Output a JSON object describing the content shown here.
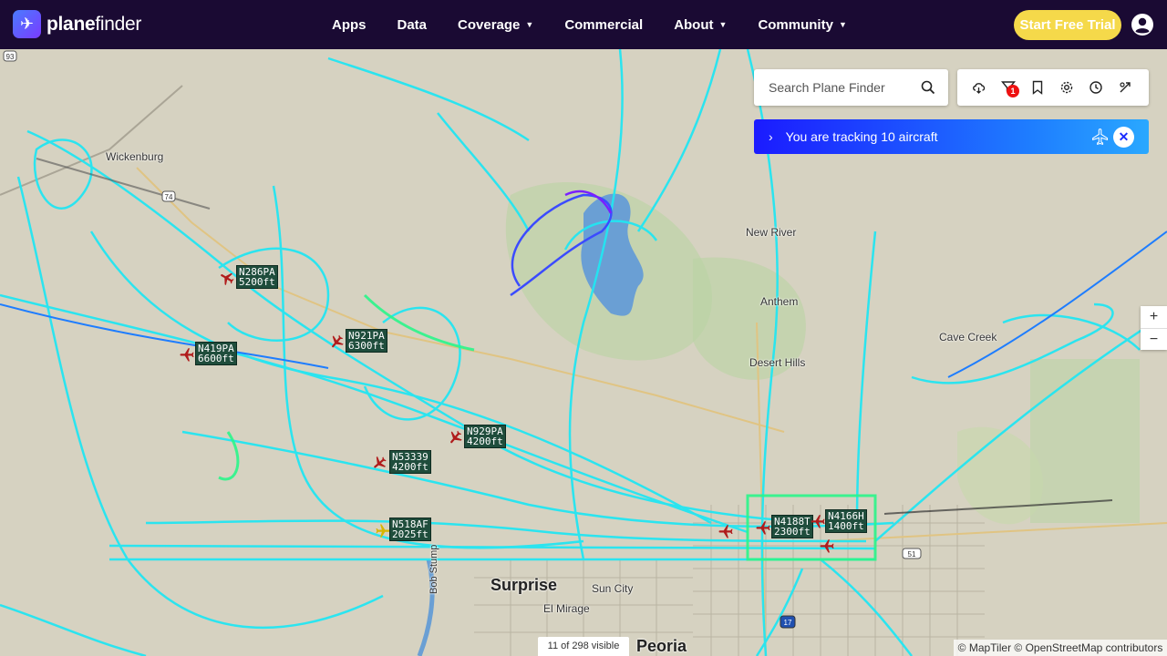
{
  "header": {
    "brand": "planefinder",
    "nav": [
      {
        "label": "Apps",
        "dropdown": false
      },
      {
        "label": "Data",
        "dropdown": false
      },
      {
        "label": "Coverage",
        "dropdown": true
      },
      {
        "label": "Commercial",
        "dropdown": false
      },
      {
        "label": "About",
        "dropdown": true
      },
      {
        "label": "Community",
        "dropdown": true
      }
    ],
    "trial_button": "Start Free Trial",
    "user_icon": "account-circle-icon"
  },
  "search": {
    "placeholder": "Search Plane Finder",
    "icon": "search-icon"
  },
  "toolbar": {
    "icons": [
      "weather-cloud-icon",
      "filter-icon",
      "bookmark-icon",
      "settings-gear-icon",
      "history-clock-icon",
      "airport-icon"
    ],
    "filter_badge": "1"
  },
  "tracking": {
    "text": "You are tracking 10 aircraft",
    "close_icon": "close-icon"
  },
  "map": {
    "places": [
      {
        "name": "Wickenburg",
        "big": false
      },
      {
        "name": "New River",
        "big": false
      },
      {
        "name": "Anthem",
        "big": false
      },
      {
        "name": "Desert Hills",
        "big": false
      },
      {
        "name": "Cave Creek",
        "big": false
      },
      {
        "name": "Surprise",
        "big": true
      },
      {
        "name": "Sun City",
        "big": false
      },
      {
        "name": "El Mirage",
        "big": false
      },
      {
        "name": "Peoria",
        "big": true
      },
      {
        "name": "Bob Stump",
        "big": false
      }
    ],
    "shields": [
      "93",
      "74",
      "51",
      "17"
    ],
    "aircraft": [
      {
        "callsign": "N286PA",
        "altitude": "5200ft"
      },
      {
        "callsign": "N921PA",
        "altitude": "6300ft"
      },
      {
        "callsign": "N419PA",
        "altitude": "6600ft"
      },
      {
        "callsign": "N929PA",
        "altitude": "4200ft"
      },
      {
        "callsign": "N53339",
        "altitude": "4200ft"
      },
      {
        "callsign": "N518AF",
        "altitude": "2025ft"
      },
      {
        "callsign": "N4188T",
        "altitude": "2300ft"
      },
      {
        "callsign": "N4166H",
        "altitude": "1400ft"
      }
    ],
    "zoom_in": "+",
    "zoom_out": "−",
    "visible_count": "11 of 298 visible",
    "attribution": "© MapTiler © OpenStreetMap contributors"
  },
  "colors": {
    "header_bg": "#1a0a33",
    "trial_button": "#f5d94a",
    "track_cyan": "#22e6f2",
    "track_green": "#2af58a",
    "track_blue": "#1e7dff",
    "tracking_bar": "#1b1bff",
    "aircraft_red": "#b01c1c"
  }
}
